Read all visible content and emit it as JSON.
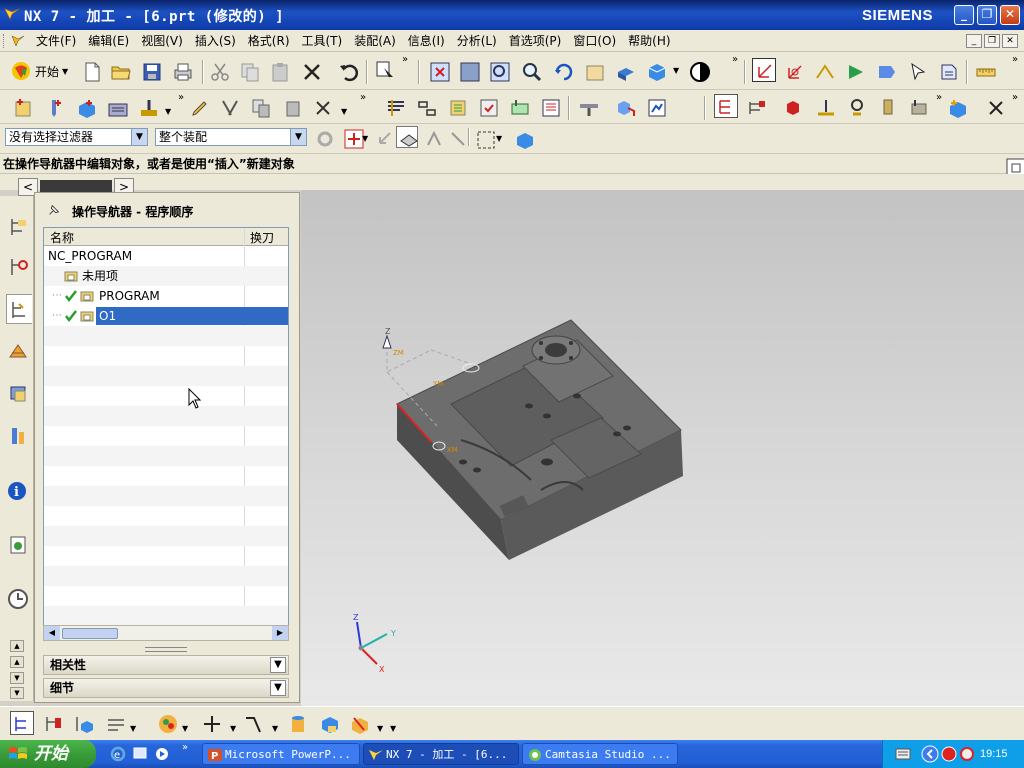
{
  "window": {
    "title": "NX 7 - 加工 - [6.prt (修改的) ]",
    "brand": "SIEMENS",
    "min_label": "_",
    "max_label": "❐",
    "close_label": "✕"
  },
  "menu": {
    "items": [
      "文件(F)",
      "编辑(E)",
      "视图(V)",
      "插入(S)",
      "格式(R)",
      "工具(T)",
      "装配(A)",
      "信息(I)",
      "分析(L)",
      "首选项(P)",
      "窗口(O)",
      "帮助(H)"
    ]
  },
  "toolbar": {
    "start_label": "开始",
    "filter_select": "没有选择过滤器",
    "assembly_select": "整个装配"
  },
  "cue_line": "在操作导航器中编辑对象，或者是使用“插入”新建对象",
  "navigator": {
    "title": "操作导航器 - 程序顺序",
    "columns": {
      "name": "名称",
      "toolchange": "换刀"
    },
    "rows": [
      {
        "label": "NC_PROGRAM",
        "checked": false,
        "selected": false
      },
      {
        "label": "未用项",
        "checked": false,
        "selected": false
      },
      {
        "label": "PROGRAM",
        "checked": true,
        "selected": false
      },
      {
        "label": "O1",
        "checked": true,
        "selected": true
      }
    ],
    "sections": {
      "dependencies": "相关性",
      "details": "细节"
    }
  },
  "viewport": {
    "triad_labels": {
      "x": "X",
      "y": "Y",
      "z": "Z"
    },
    "mcs_labels": {
      "zm": "ZM",
      "ym": "YM",
      "xm": "XM"
    }
  },
  "taskbar": {
    "start_label": "开始",
    "tasks": [
      {
        "label": "Microsoft PowerP...",
        "active": false
      },
      {
        "label": "NX 7 - 加工 - [6...",
        "active": true
      },
      {
        "label": "Camtasia Studio ...",
        "active": false
      }
    ],
    "clock": "19:15"
  },
  "icons": {
    "app": "nx-logo-icon",
    "pointer": "mouse-pointer-icon"
  },
  "colors": {
    "title_bar": "#0a246a",
    "selection": "#316ac5",
    "taskbar": "#2160d5",
    "start_button": "#3a9b3a",
    "part": "#6f6f6f"
  }
}
